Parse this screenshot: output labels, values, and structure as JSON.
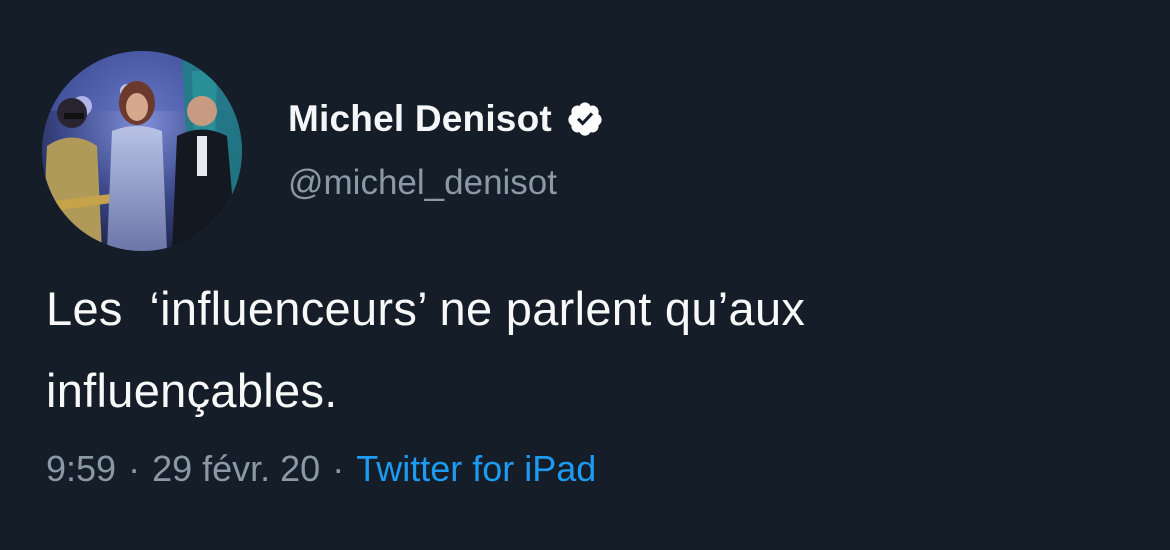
{
  "author": {
    "display_name": "Michel Denisot",
    "handle": "@michel_denisot",
    "verified": true
  },
  "tweet": {
    "text": "Les  ‘influenceurs’ ne parlent qu’aux\ninfluençables.",
    "time": "9:59",
    "date": "29 févr. 20",
    "source": "Twitter for iPad",
    "separator": "·"
  },
  "colors": {
    "background": "#151d28",
    "secondary_text": "#8b98a5",
    "link": "#1d9bf0"
  },
  "icons": {
    "verified": "verified-badge-icon",
    "avatar": "profile-photo"
  }
}
